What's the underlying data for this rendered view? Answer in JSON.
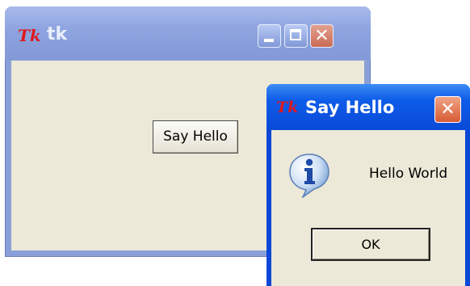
{
  "main_window": {
    "title": "tk",
    "logo_text": "Tk",
    "say_hello_label": "Say Hello",
    "titlebar_buttons": [
      "minimize-icon",
      "maximize-icon",
      "close-icon"
    ]
  },
  "dialog": {
    "title": "Say Hello",
    "logo_text": "Tk",
    "icon": "info-icon",
    "message": "Hello World",
    "ok_label": "OK"
  },
  "colors": {
    "inactive_titlebar": "#8fa5e0",
    "active_titlebar": "#0d5ce8",
    "client_bg": "#ece9d8",
    "close_button": "#d75b34",
    "tk_logo": "#e0191e"
  }
}
